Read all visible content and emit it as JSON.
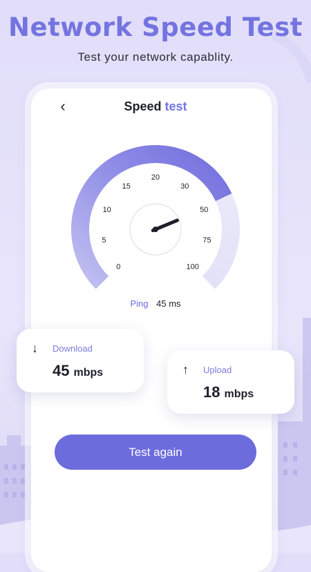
{
  "hero": {
    "title": "Network Speed Test",
    "subtitle": "Test your network capablity."
  },
  "header": {
    "back_icon": "chevron-left-icon",
    "title_main": "Speed",
    "title_accent": "test"
  },
  "gauge": {
    "tick_labels": [
      "0",
      "5",
      "10",
      "15",
      "20",
      "30",
      "50",
      "75",
      "100"
    ],
    "needle_value": 50,
    "fill_fraction": 0.74
  },
  "ping": {
    "label": "Ping",
    "value": "45 ms"
  },
  "download": {
    "icon": "arrow-down-icon",
    "label": "Download",
    "value": "45",
    "unit": "mbps"
  },
  "upload": {
    "icon": "arrow-up-icon",
    "label": "Upload",
    "value": "18",
    "unit": "mbps"
  },
  "button": {
    "label": "Test again"
  },
  "colors": {
    "accent": "#6c6cdc",
    "light_accent": "#e6e6f8"
  }
}
